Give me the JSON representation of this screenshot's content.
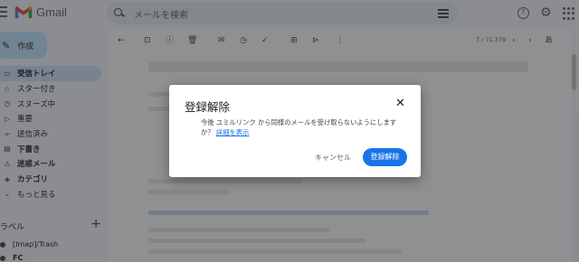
{
  "app": {
    "name": "Gmail"
  },
  "search": {
    "placeholder": "メールを検索"
  },
  "sidebar": {
    "compose_label": "作成",
    "items": [
      {
        "label": "受信トレイ",
        "icon": "inbox-icon",
        "glyph": "▭",
        "state": "active"
      },
      {
        "label": "スター付き",
        "icon": "star-icon",
        "glyph": "☆",
        "state": ""
      },
      {
        "label": "スヌーズ中",
        "icon": "clock-icon",
        "glyph": "◷",
        "state": ""
      },
      {
        "label": "重要",
        "icon": "important-icon",
        "glyph": "▷",
        "state": ""
      },
      {
        "label": "送信済み",
        "icon": "send-icon",
        "glyph": "➢",
        "state": ""
      },
      {
        "label": "下書き",
        "icon": "draft-icon",
        "glyph": "▤",
        "state": "bold"
      },
      {
        "label": "迷惑メール",
        "icon": "spam-icon",
        "glyph": "⚠",
        "state": "bold"
      },
      {
        "label": "カテゴリ",
        "icon": "category-icon",
        "glyph": "◈",
        "state": "bold"
      },
      {
        "label": "もっと見る",
        "icon": "chevron-down-icon",
        "glyph": "⌄",
        "state": ""
      }
    ],
    "labels_heading": "ラベル",
    "label_items": [
      "[Imap]/Trash",
      "FC"
    ]
  },
  "toolbar": {
    "pager": "7 / 71,379",
    "input_tool": "あ"
  },
  "dialog": {
    "title": "登録解除",
    "body": "今後 ユミルリンク から同様のメールを受け取らないようにしますか？",
    "link": "詳細を表示",
    "cancel": "キャンセル",
    "confirm": "登録解除"
  },
  "colors": {
    "accent": "#1a73e8",
    "overlay": "#202124"
  }
}
